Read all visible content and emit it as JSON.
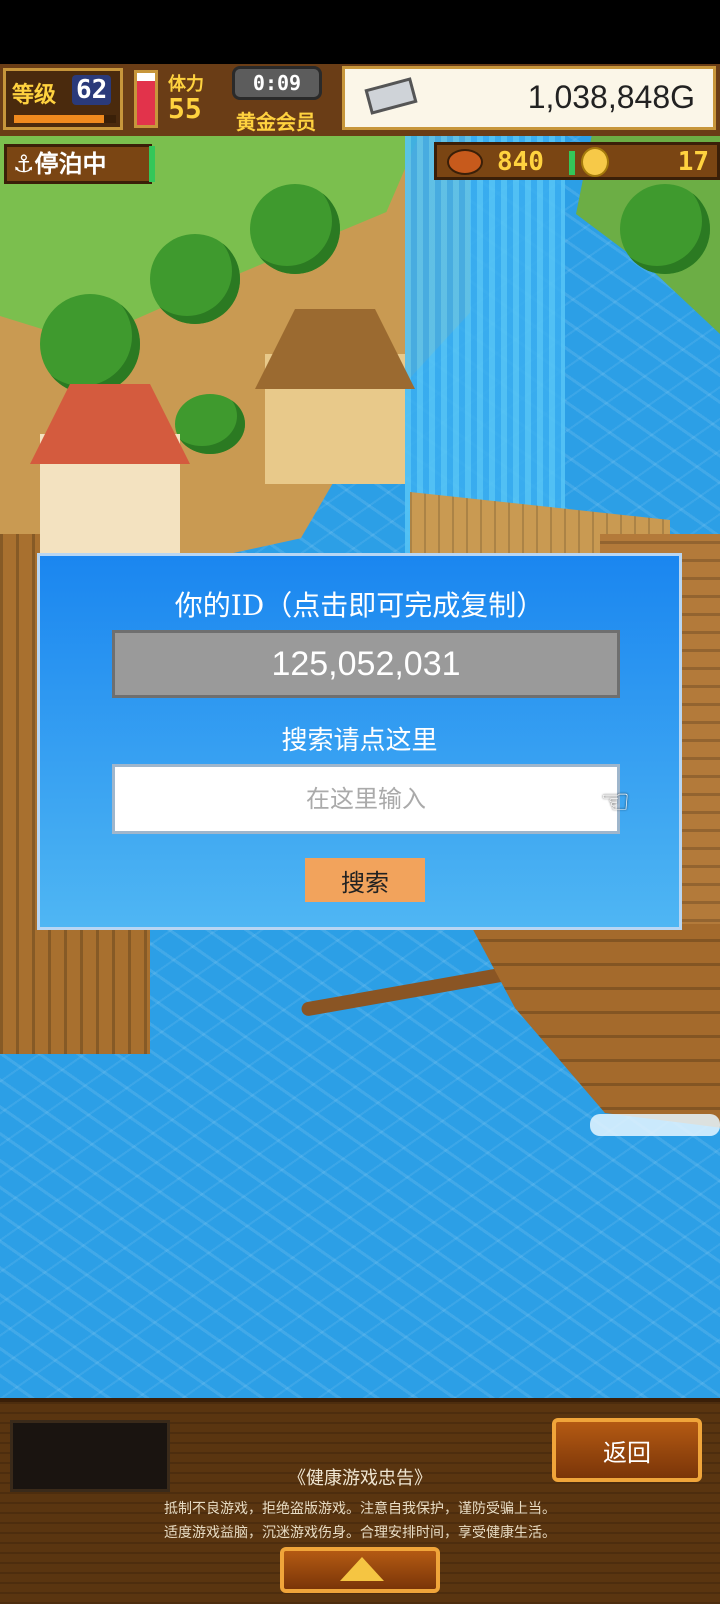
{
  "hud": {
    "level_label": "等级",
    "level_value": "62",
    "xp_progress": 0.88,
    "stamina_label": "体力",
    "stamina_value": "55",
    "stamina_level": 0.85,
    "timer": "0:09",
    "member_badge": "黄金会员",
    "money": "1,038,848G",
    "anchor_status": "停泊中",
    "food": "840",
    "coins": "17"
  },
  "dialog": {
    "id_title": "你的ID（点击即可完成复制）",
    "id_value": "125,052,031",
    "search_title": "搜索请点这里",
    "search_placeholder": "在这里输入",
    "search_value": "",
    "search_button": "搜索"
  },
  "footer": {
    "back_button": "返回",
    "advisory_title": "《健康游戏忠告》",
    "advisory_line1": "抵制不良游戏，拒绝盗版游戏。注意自我保护，谨防受骗上当。",
    "advisory_line2": "适度游戏益脑，沉迷游戏伤身。合理安排时间，享受健康生活。"
  },
  "icons": {
    "anchor": "anchor-icon",
    "silver_ingot": "silver-ingot-icon",
    "food": "food-icon",
    "coin": "gold-coin-icon",
    "pointer": "pointing-hand-icon",
    "expand": "triangle-up-icon"
  },
  "colors": {
    "dialog_top": "#1a86f0",
    "dialog_bottom": "#4fb6f3",
    "search_button": "#f2a35c",
    "hud_gold": "#ffd23f"
  }
}
